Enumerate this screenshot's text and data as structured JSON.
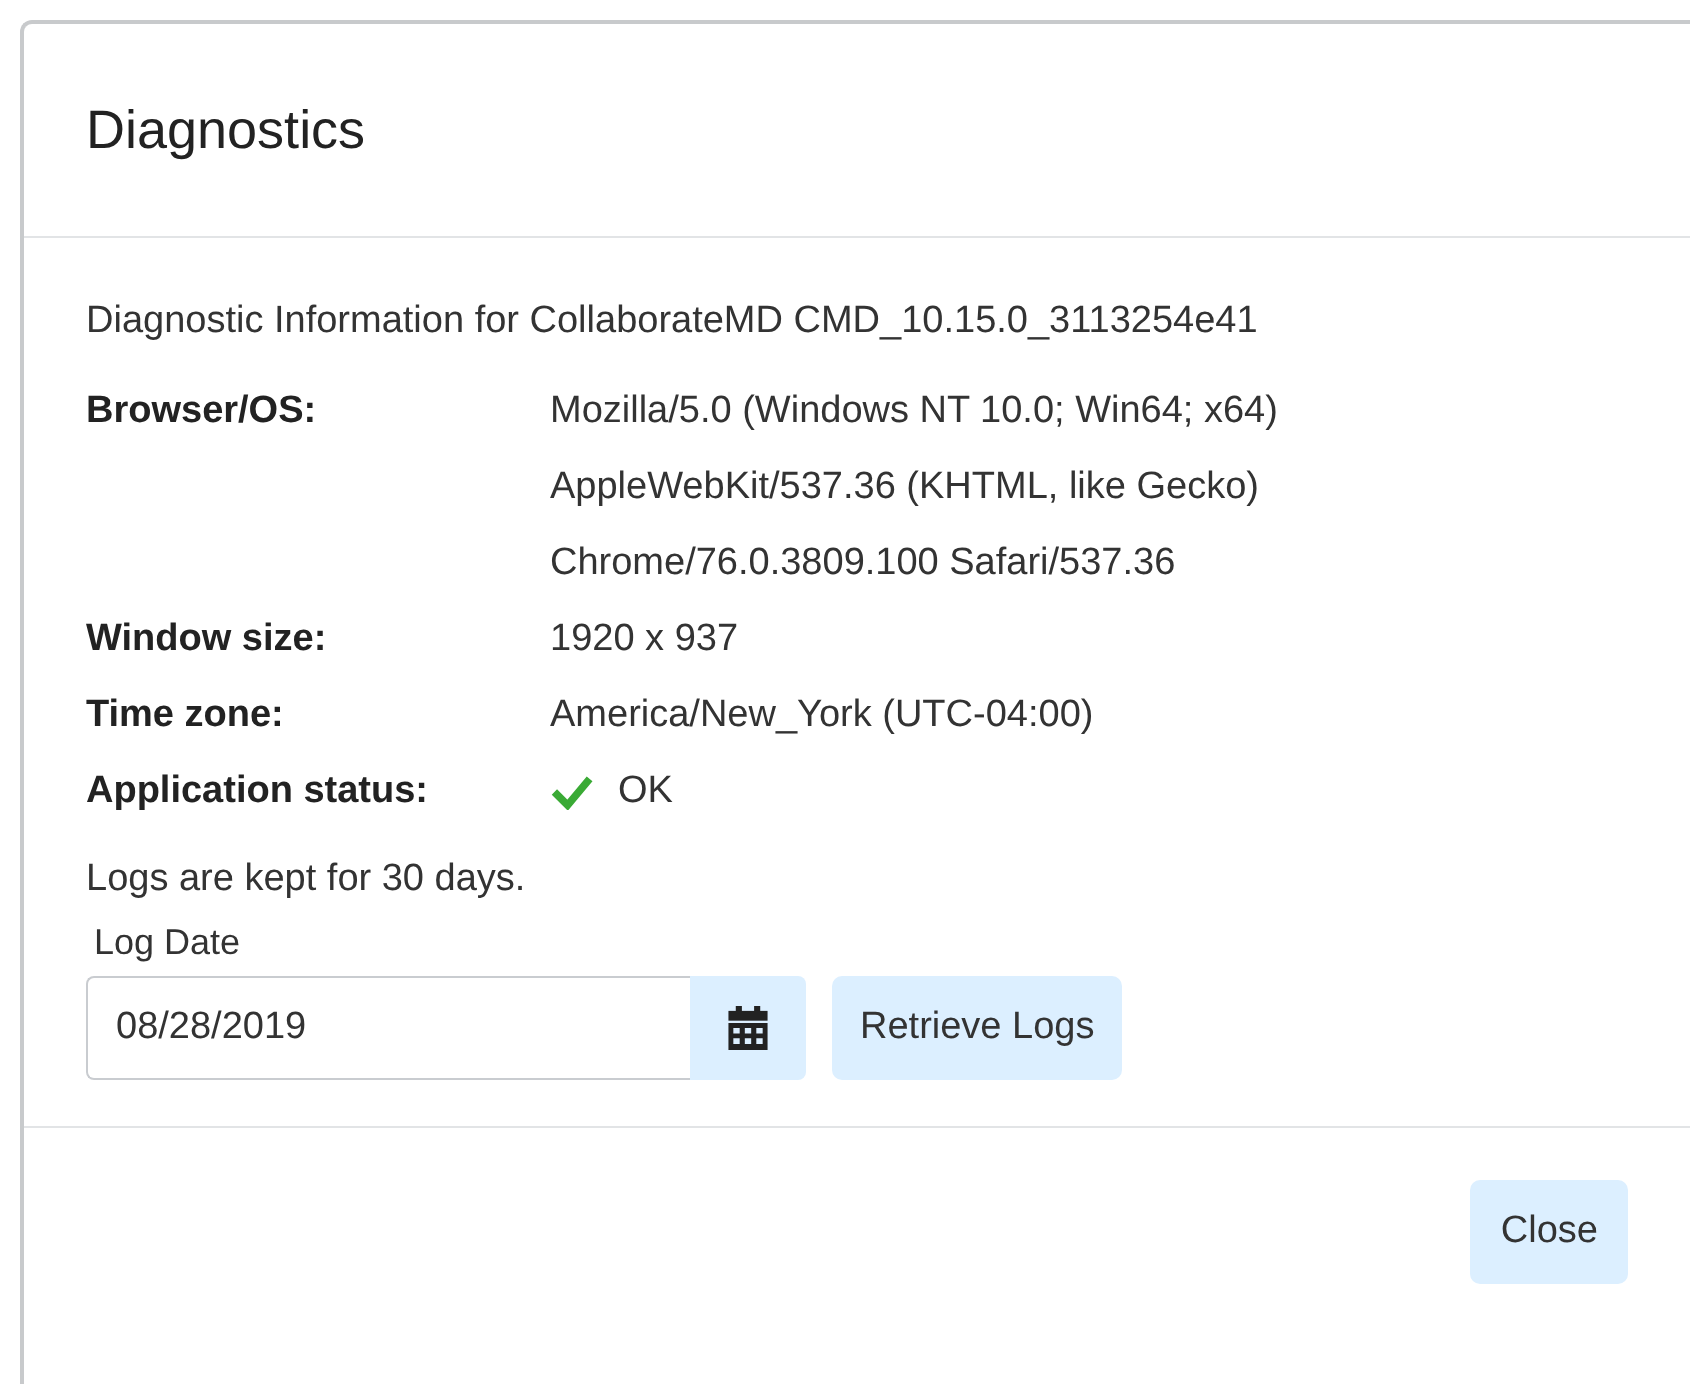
{
  "dialog": {
    "title": "Diagnostics",
    "intro": "Diagnostic Information for CollaborateMD CMD_10.15.0_3113254e41",
    "rows": [
      {
        "kind": "text",
        "label": "Browser/OS:",
        "lines": [
          "Mozilla/5.0 (Windows NT 10.0; Win64; x64)",
          "AppleWebKit/537.36 (KHTML, like Gecko)",
          "Chrome/76.0.3809.100 Safari/537.36"
        ]
      },
      {
        "kind": "text",
        "label": "Window size:",
        "lines": [
          "1920 x 937"
        ]
      },
      {
        "kind": "text",
        "label": "Time zone:",
        "lines": [
          "America/New_York (UTC-04:00)"
        ]
      },
      {
        "kind": "status",
        "label": "Application status:",
        "ok": true,
        "lines": [
          "OK"
        ]
      }
    ],
    "retention_note": "Logs are kept for 30 days.",
    "log_date": {
      "label": "Log Date",
      "value": "08/28/2019"
    },
    "retrieve_button": "Retrieve Logs",
    "close_button": "Close"
  }
}
